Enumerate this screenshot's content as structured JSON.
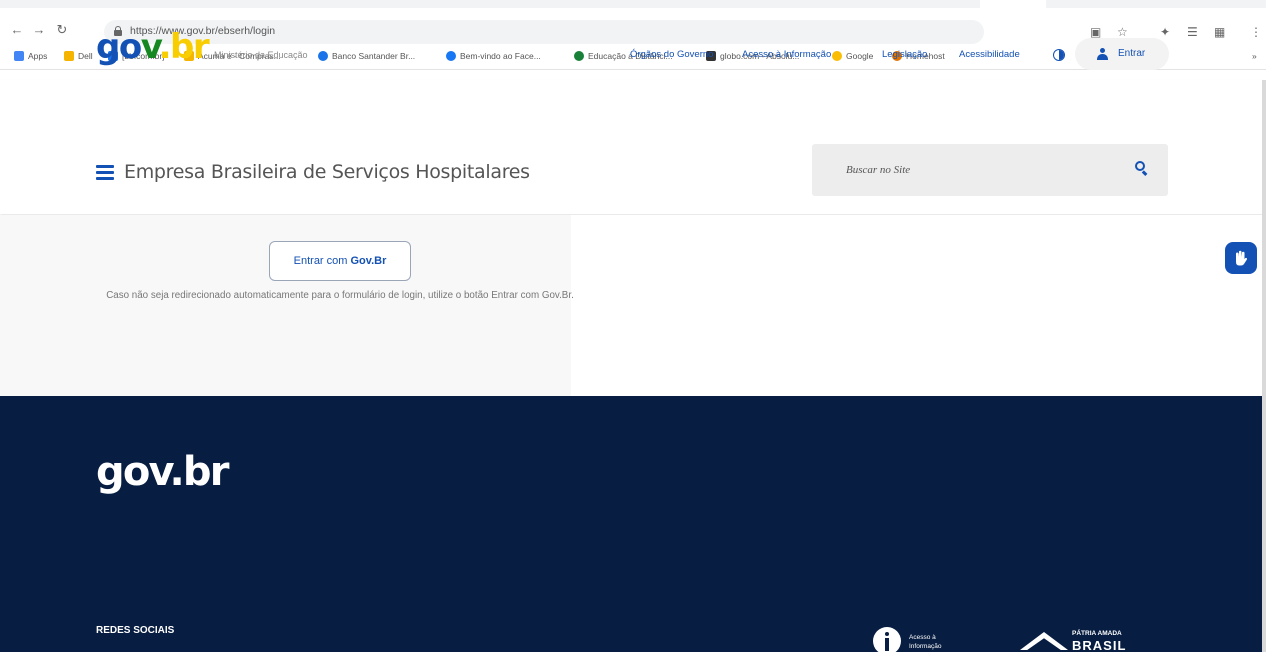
{
  "browser": {
    "url": "https://www.gov.br/ebserh/login",
    "bookmarks": [
      {
        "label": "Apps",
        "color": "#4285f4"
      },
      {
        "label": "Dell",
        "color": "#f4b400"
      },
      {
        "label": "[bb.com.br]",
        "color": "#1a73e8"
      },
      {
        "label": "Acuma é - Compras...",
        "color": "#f4b400"
      },
      {
        "label": "Banco Santander Br...",
        "color": "#1a73e8"
      },
      {
        "label": "Bem-vindo ao Face...",
        "color": "#1877f2"
      },
      {
        "label": "Educação a Distânci...",
        "color": "#188038"
      },
      {
        "label": "globo.com - Absolu...",
        "color": "#333333"
      },
      {
        "label": "Google",
        "color": "#fbbc04"
      },
      {
        "label": "Homehost",
        "color": "#e37400"
      }
    ]
  },
  "header": {
    "logo": {
      "part1": "go",
      "part2": "v",
      "part3": ".br"
    },
    "ministry": "Ministério da Educação",
    "links": [
      "Órgãos do Governo",
      "Acesso à Informação",
      "Legislação",
      "Acessibilidade"
    ],
    "login_label": "Entrar",
    "org_name": "Empresa Brasileira de Serviços Hospitalares",
    "search_placeholder": "Buscar no Site"
  },
  "main": {
    "button_prefix": "Entrar com ",
    "button_brand": "Gov.Br",
    "redirect_text": "Caso não seja redirecionado automaticamente para o formulário de login, utilize o botão Entrar com Gov.Br."
  },
  "footer": {
    "logo": "gov.br",
    "social_title": "REDES SOCIAIS",
    "access_info_label": "Acesso à Informação",
    "patria_line1": "PÁTRIA AMADA",
    "patria_line2": "BRASIL"
  },
  "colors": {
    "primary": "#1351b4",
    "footer_bg": "#071d41",
    "logo_green": "#168821",
    "logo_yellow": "#f8ce00"
  }
}
